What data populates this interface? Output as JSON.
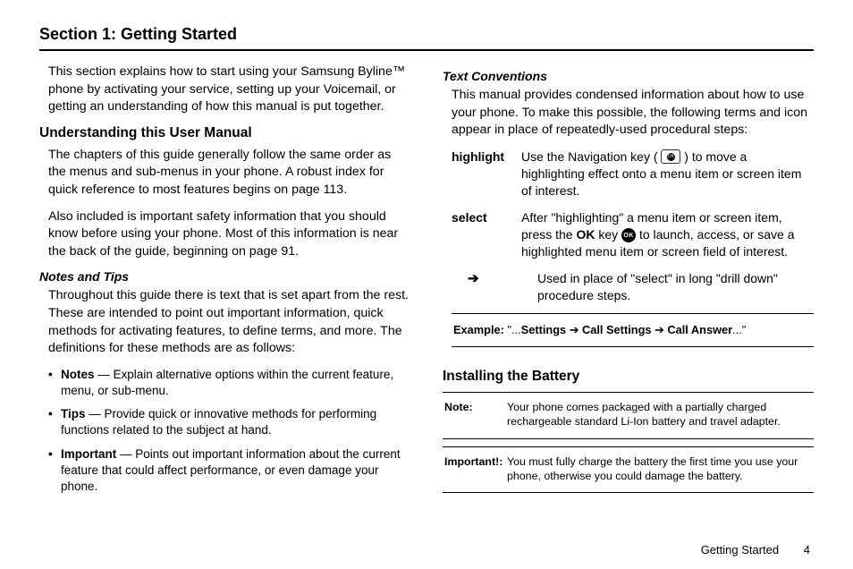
{
  "section_title": "Section 1: Getting Started",
  "left": {
    "intro": "This section explains how to start using your Samsung Byline™ phone by activating your service, setting up your Voicemail, or getting an understanding of how this manual is put together.",
    "h_understanding": "Understanding this User Manual",
    "p_chapters": "The chapters of this guide generally follow the same order as the menus and sub-menus in your phone. A robust index for quick reference to most features begins on page 113.",
    "p_safety": "Also included is important safety information that you should know before using your phone. Most of this information is near the back of the guide, beginning on page 91.",
    "h_notes": "Notes and Tips",
    "p_notes_intro": "Throughout this guide there is text that is set apart from the rest. These are intended to point out important information, quick methods for activating features, to define terms, and more. The definitions for these methods are as follows:",
    "bullets": [
      {
        "term": "Notes",
        "rest": " — Explain alternative options within the current feature, menu, or sub-menu."
      },
      {
        "term": "Tips",
        "rest": " — Provide quick or innovative methods for performing functions related to the subject at hand."
      },
      {
        "term": "Important",
        "rest": " — Points out important information about the current feature that could affect performance, or even damage your phone."
      }
    ]
  },
  "right": {
    "h_textconv": "Text Conventions",
    "p_textconv": "This manual provides condensed information about how to use your phone. To make this possible, the following terms and icon appear in place of repeatedly-used procedural steps:",
    "term_highlight_label": "highlight",
    "term_highlight_pre": "Use the Navigation key ( ",
    "term_highlight_post": " ) to move a highlighting effect onto a menu item or screen item of interest.",
    "term_select_label": "select",
    "term_select_pre": "After \"highlighting\" a menu item or screen item, press the ",
    "term_select_ok": "OK",
    "term_select_mid": " key ",
    "term_select_post": " to launch, access, or save a highlighted menu item or screen field of interest.",
    "term_arrow_def": "Used in place of \"select\" in long \"drill down\" procedure steps.",
    "example_label": "Example:",
    "example_pre": " \"...",
    "example_settings": "Settings",
    "example_callsettings": "Call Settings",
    "example_callanswer": "Call Answer",
    "example_post": "...\"",
    "h_install": "Installing the Battery",
    "note1_label": "Note:",
    "note1_text": "Your phone comes packaged with a partially charged rechargeable standard Li-Ion battery and travel adapter.",
    "note2_label": "Important!:",
    "note2_text": "You must fully charge the battery the first time you use your phone, otherwise you could damage the battery."
  },
  "footer": {
    "section": "Getting Started",
    "page": "4"
  }
}
